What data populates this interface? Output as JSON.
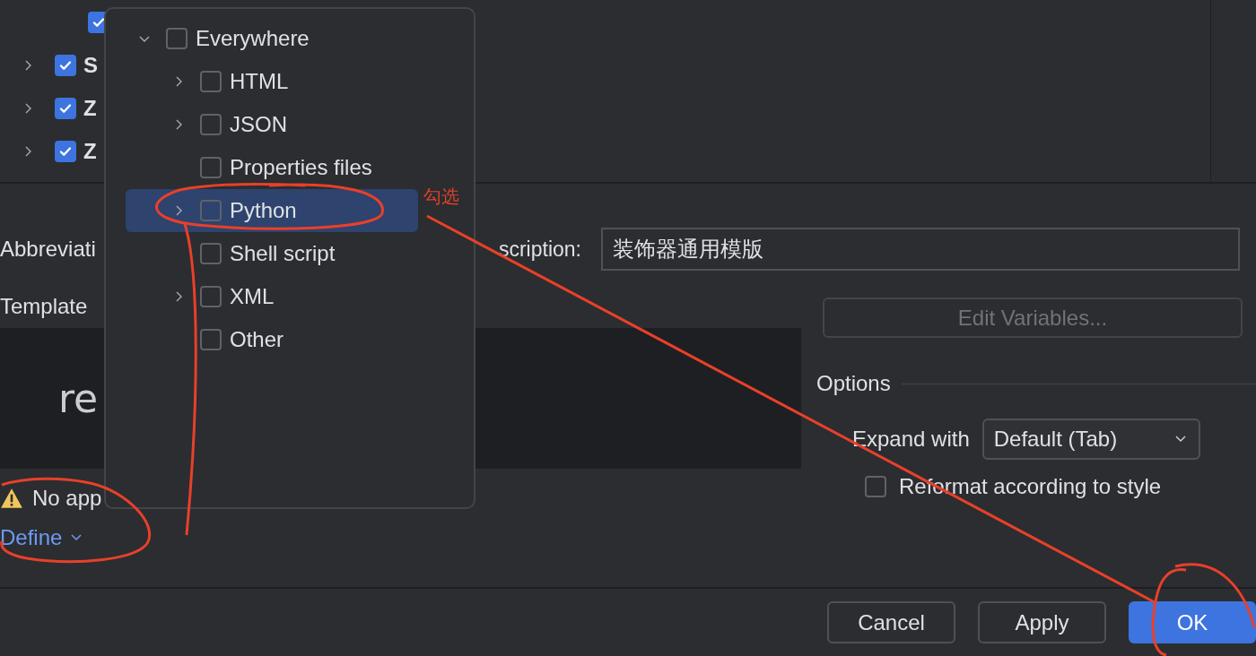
{
  "template_tree": {
    "partial_child": {
      "checked": true
    },
    "groups": [
      {
        "label": "S",
        "checked": true,
        "expanded": false
      },
      {
        "label": "Z",
        "checked": true,
        "expanded": false
      },
      {
        "label": "Z",
        "checked": true,
        "expanded": false
      }
    ]
  },
  "context_popup": {
    "root": {
      "label": "Everywhere",
      "checked": false,
      "expanded": true,
      "children": [
        {
          "label": "HTML",
          "kind": "group",
          "checked": false,
          "expanded": false,
          "selected": false
        },
        {
          "label": "JSON",
          "kind": "group",
          "checked": false,
          "expanded": false,
          "selected": false
        },
        {
          "label": "Properties files",
          "kind": "leaf",
          "checked": false,
          "selected": false
        },
        {
          "label": "Python",
          "kind": "group",
          "checked": false,
          "expanded": false,
          "selected": true
        },
        {
          "label": "Shell script",
          "kind": "leaf",
          "checked": false,
          "selected": false
        },
        {
          "label": "XML",
          "kind": "group",
          "checked": false,
          "expanded": false,
          "selected": false
        },
        {
          "label": "Other",
          "kind": "leaf",
          "checked": false,
          "selected": false
        }
      ]
    }
  },
  "form": {
    "abbreviation_label": "Abbreviati",
    "description_label": "scription:",
    "description_value": "装饰器通用模版",
    "template_label": "Template",
    "editor_text": "re",
    "edit_variables": {
      "label": "Edit Variables...",
      "disabled": true
    },
    "warning": "No app",
    "define_link": "Define"
  },
  "options": {
    "title": "Options",
    "expand_with_label": "Expand with",
    "expand_with_value": "Default (Tab)",
    "reformat": {
      "label": "Reformat according to style",
      "checked": false
    }
  },
  "buttons": [
    {
      "label": "Cancel",
      "kind": "secondary"
    },
    {
      "label": "Apply",
      "kind": "secondary"
    },
    {
      "label": "OK",
      "kind": "primary"
    }
  ],
  "annotation": {
    "note": "勾选"
  }
}
